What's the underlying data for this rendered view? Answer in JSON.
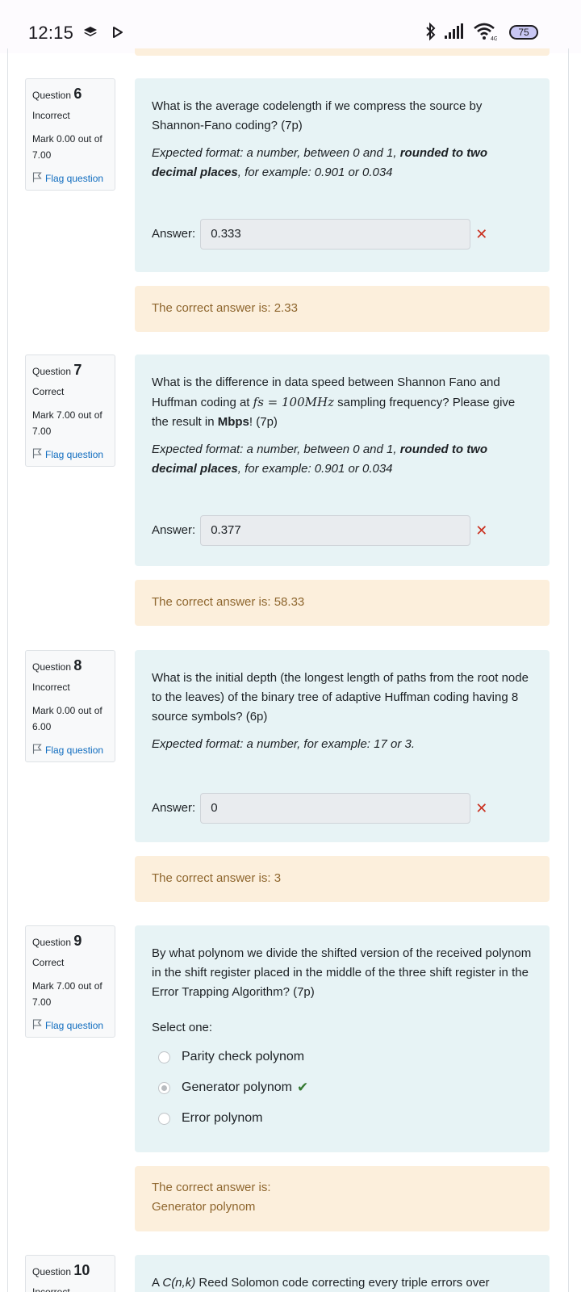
{
  "status_bar": {
    "time": "12:15",
    "battery": "75",
    "icons": [
      "notification-stack-icon",
      "play-arrow-icon",
      "bluetooth-icon",
      "cellular-signal-icon",
      "wifi-icon",
      "battery-icon"
    ]
  },
  "questions": [
    {
      "number_prefix": "Question",
      "number": "6",
      "state": "Incorrect",
      "grade": "Mark 0.00 out of 7.00",
      "flag_label": "Flag question",
      "text": "What is the average codelength if we compress the source by Shannon-Fano coding? (7p)",
      "format_pre": "Expected format: a number, between 0 and 1, ",
      "format_bold": "rounded to two decimal places",
      "format_post": ", for example: 0.901 or 0.034",
      "answer_label": "Answer:",
      "answer_value": "0.333",
      "feedback_text": "The correct answer is: 2.33"
    },
    {
      "number_prefix": "Question",
      "number": "7",
      "state": "Correct",
      "grade": "Mark 7.00 out of 7.00",
      "flag_label": "Flag question",
      "text_pre": "What is the difference in data speed between Shannon Fano and Huffman coding at ",
      "text_math": "fs = 100MHz",
      "text_mid": " sampling frequency? Please give the result in ",
      "text_bold": "Mbps",
      "text_post": "! (7p)",
      "format_pre": "Expected format: a number, between 0 and 1, ",
      "format_bold": "rounded to two decimal places",
      "format_post": ", for example: 0.901 or 0.034",
      "answer_label": "Answer:",
      "answer_value": "0.377",
      "feedback_text": "The correct answer is: 58.33"
    },
    {
      "number_prefix": "Question",
      "number": "8",
      "state": "Incorrect",
      "grade": "Mark 0.00 out of 6.00",
      "flag_label": "Flag question",
      "text": "What is the initial depth (the longest length of paths from the root node to the leaves) of the binary tree of adaptive Huffman coding having 8 source symbols? (6p)",
      "format_text": "Expected format: a number, for example: 17 or 3.",
      "answer_label": "Answer:",
      "answer_value": "0",
      "feedback_text": "The correct answer is: 3"
    },
    {
      "number_prefix": "Question",
      "number": "9",
      "state": "Correct",
      "grade": "Mark 7.00 out of 7.00",
      "flag_label": "Flag question",
      "text": "By what polynom we divide the shifted version of the received polynom in the shift register placed in the middle of the three shift register in the Error Trapping Algorithm? (7p)",
      "select_label": "Select one:",
      "options": [
        "Parity check polynom",
        "Generator polynom",
        "Error polynom"
      ],
      "selected_option": "Generator polynom",
      "feedback_line1": "The correct answer is:",
      "feedback_line2": "Generator polynom"
    },
    {
      "number_prefix": "Question",
      "number": "10",
      "state": "Incorrect",
      "text_pre": "A ",
      "text_italic": "C(n,k)",
      "text_post": " Reed Solomon code correcting every triple errors over"
    }
  ]
}
